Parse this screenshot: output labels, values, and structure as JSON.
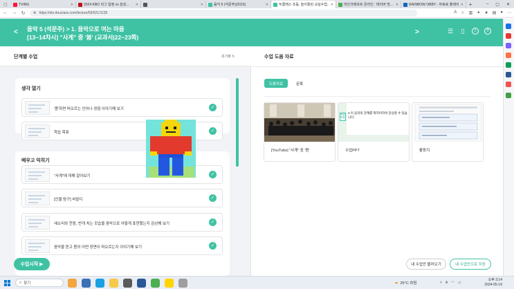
{
  "browser": {
    "tabs": [
      {
        "label": "TVING",
        "color": "#ff153c",
        "active": false
      },
      {
        "label": "2024 KBO 리그 일정 vs 삼성...",
        "color": "#c1121f",
        "active": false
      },
      {
        "label": "",
        "color": "#555555",
        "active": false
      },
      {
        "label": "음악 5 (석문주)(2015)",
        "color": "#3fc2a4",
        "active": false
      },
      {
        "label": "두클래스 초등, 놀이툴린 교실수업...",
        "color": "#3fc2a4",
        "active": true
      },
      {
        "label": "마인크래프트 온라인 : 테이버 멋...",
        "color": "#4caf50",
        "active": false
      },
      {
        "label": "RAINBOW OBBY - 무료로 플레이...",
        "color": "#1565c0",
        "active": false
      }
    ],
    "url": "https://ele.douclass.com/lecture/56/521/1135"
  },
  "header": {
    "back": "<",
    "title_line1": "음악 5 (석문주) > 1. 음악으로 여는 마음",
    "title_line2": "[13~14차시] \"사계\" 중 '봄' (교과서|22~23쪽)",
    "next": ">",
    "icons": [
      "menu-icon",
      "bookmark-icon",
      "info-icon",
      "help-icon"
    ]
  },
  "left": {
    "title": "단계별 수업",
    "reset": "초기화 ↻",
    "sections": [
      {
        "title": "생각 열기",
        "items": [
          {
            "label": "'봄'하면 떠오르는 단어나 경험 이야기해 보기",
            "done": true
          },
          {
            "label": "학습 목표",
            "done": true
          }
        ]
      },
      {
        "title": "배우고 익히기",
        "items": [
          {
            "label": "\"사계\"에 대해 알아보기",
            "done": true
          },
          {
            "label": "[인물 탐구] 비발디",
            "done": true
          },
          {
            "label": "새소리와 천둥, 번개 치는 모습을 음악으로 어떻게 표현했는지 감상해 보기",
            "done": true
          },
          {
            "label": "음악을 듣고 봄의 어떤 장면이 떠오르는지 이야기해 보기",
            "done": true
          }
        ]
      }
    ],
    "start_button": "수업시작 ▶"
  },
  "right": {
    "title": "수업 도움 자료",
    "tabs": [
      "도움자료",
      "문록"
    ],
    "cards": [
      {
        "label": "[YouTube] \"사계\" 중 '봄'"
      },
      {
        "label": "수업PPT",
        "slide_text": "4 이 음악의 관계를 짝지어하며 감상할 수 있습니다.",
        "badge": "학습 목표"
      },
      {
        "label": "활동지"
      }
    ],
    "load_button": "내 수업안 불러오기",
    "save_button": "내 수업안으로 저장"
  },
  "taskbar": {
    "search_placeholder": "찾기",
    "weather": "25°C 흐림",
    "clock_time": "오후 3:14",
    "clock_date": "2024-05-19"
  }
}
